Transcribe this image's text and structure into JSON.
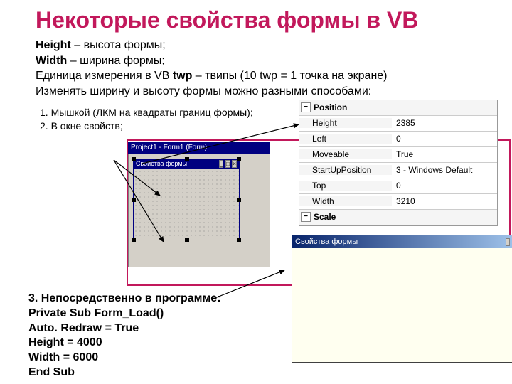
{
  "title": "Некоторые свойства формы в VB",
  "intro": {
    "l1a": "Height",
    "l1b": " – высота формы;",
    "l2a": "Width",
    "l2b": " – ширина формы;",
    "l3a": "Единица измерения в VB ",
    "l3b": "twp",
    "l3c": " – твипы (10 twp = 1 точка на экране)",
    "l4": "Изменять ширину и высоту формы можно разными способами:"
  },
  "method1": {
    "line1": "1. Мышкой (ЛКМ на квадраты границ формы);",
    "line2": "2. В окне свойств;"
  },
  "formDesigner": {
    "outerTitle": "Project1 - Form1 (Form)",
    "innerTitle": "Свойства формы"
  },
  "props": {
    "cat1": "Position",
    "rows": [
      {
        "k": "Height",
        "v": "2385"
      },
      {
        "k": "Left",
        "v": "0"
      },
      {
        "k": "Moveable",
        "v": "True"
      },
      {
        "k": "StartUpPosition",
        "v": "3 - Windows Default"
      },
      {
        "k": "Top",
        "v": "0"
      },
      {
        "k": "Width",
        "v": "3210"
      }
    ],
    "cat2": "Scale"
  },
  "win2": {
    "title": "Свойства формы"
  },
  "method3": {
    "l1": "3. Непосредственно в программе:",
    "l2": "Private Sub Form_Load()",
    "l3": "Auto. Redraw = True",
    "l4": "Height = 4000",
    "l5": "Width = 6000",
    "l6": "End Sub"
  },
  "winbuttons": {
    "min": "_",
    "max": "□",
    "close": "×"
  }
}
